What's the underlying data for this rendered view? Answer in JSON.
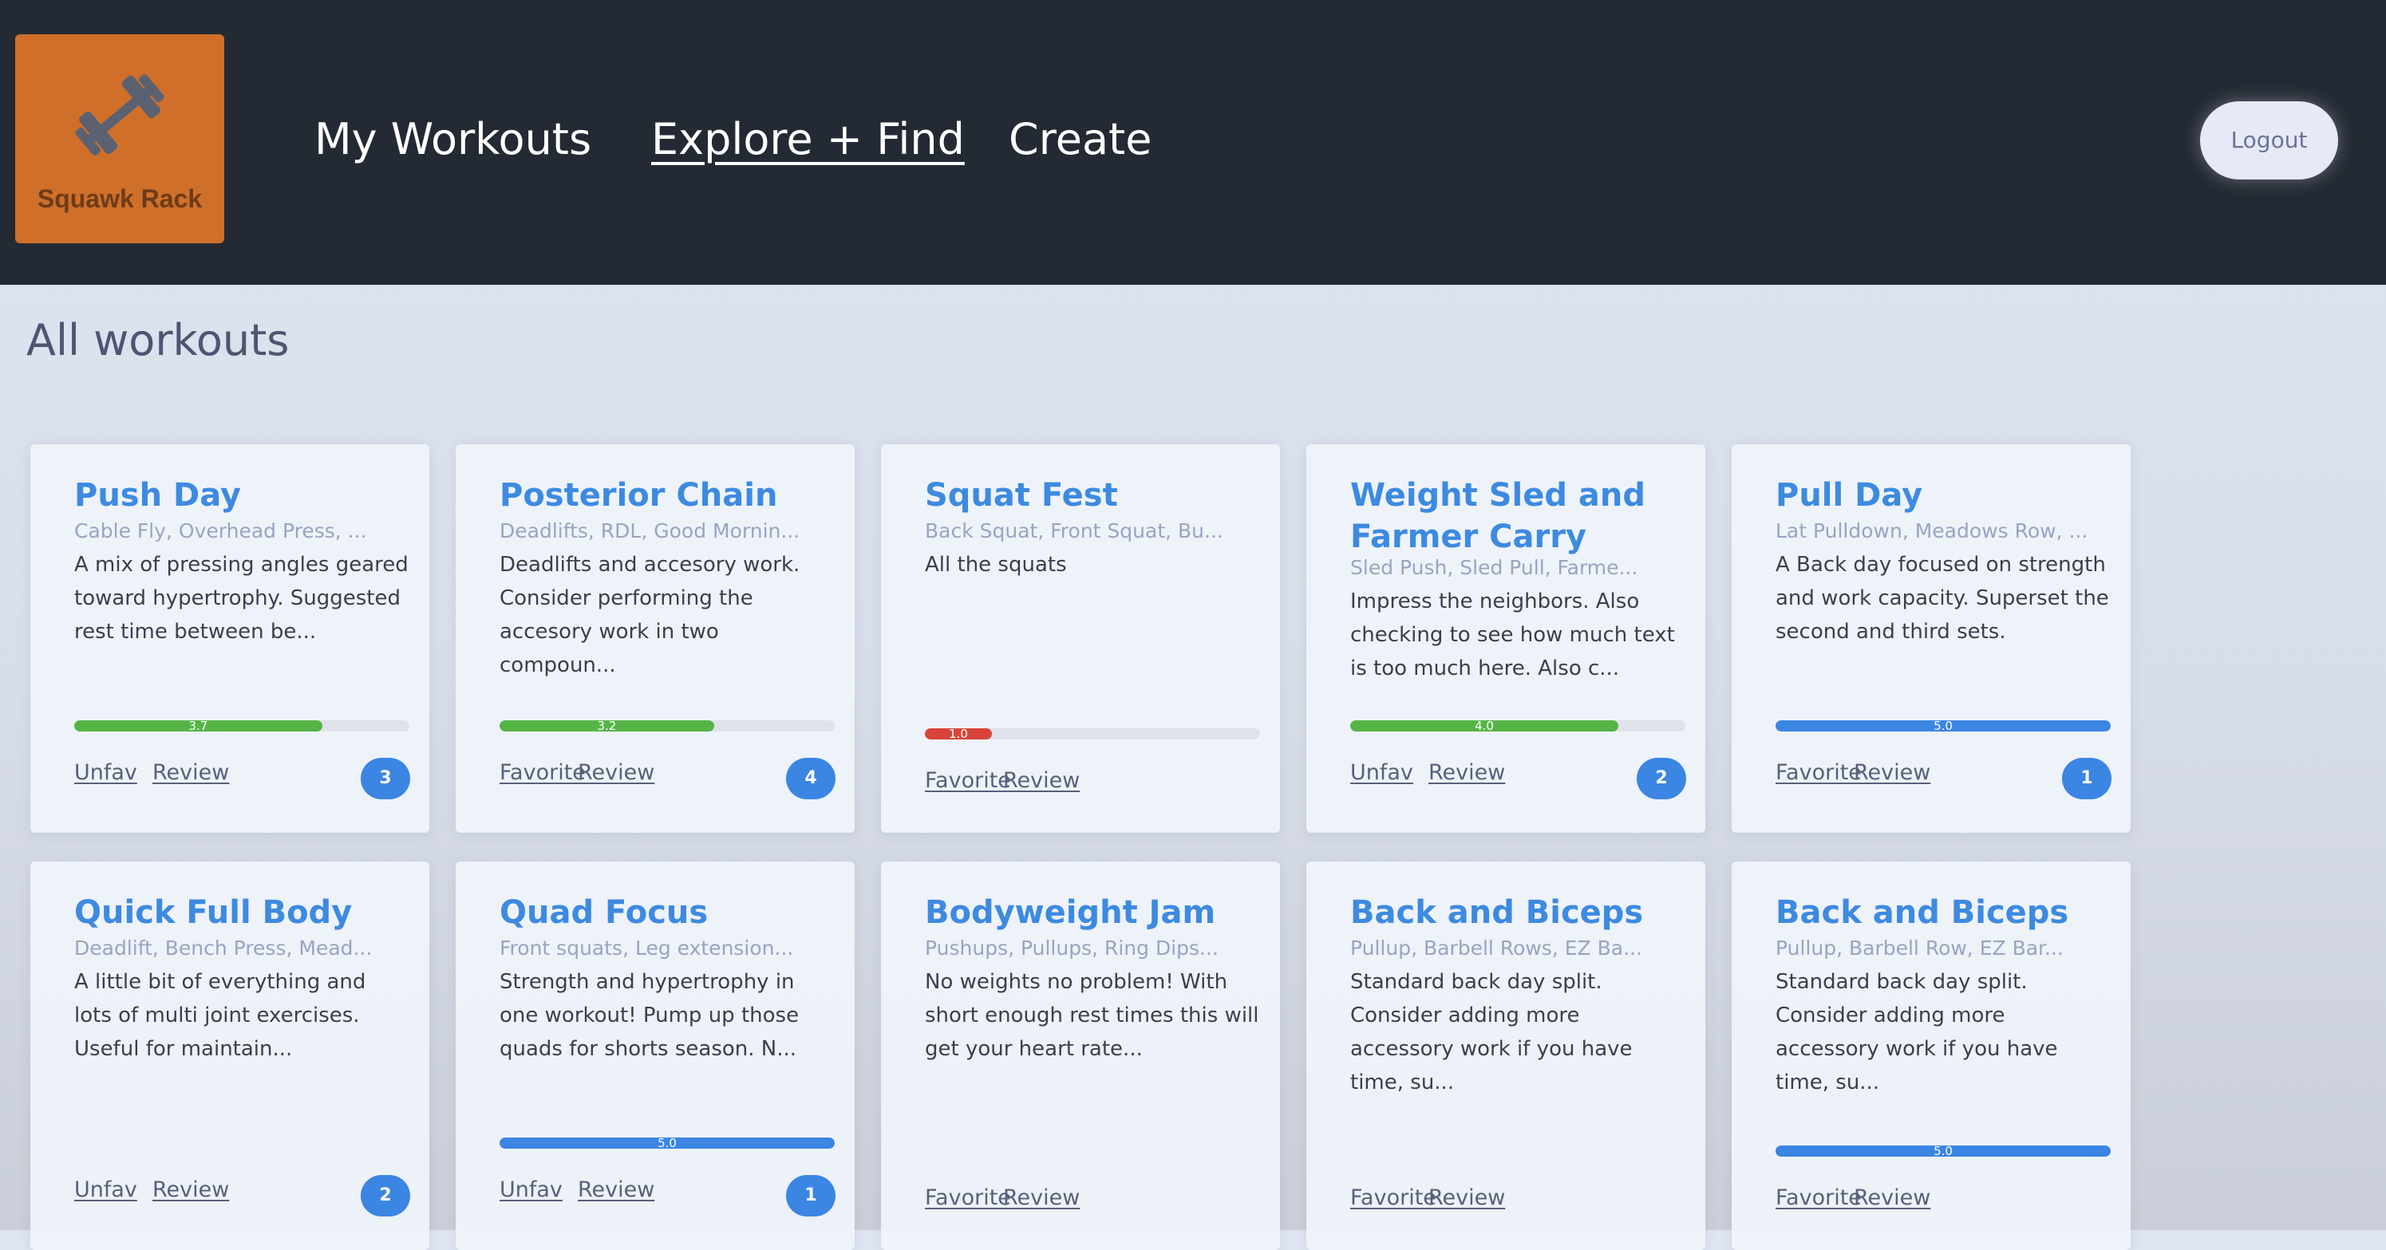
{
  "app": {
    "logo_text": "Squawk Rack",
    "nav": [
      {
        "label": "My Workouts"
      },
      {
        "label": "Explore + Find"
      },
      {
        "label": "Create"
      }
    ],
    "logout_label": "Logout"
  },
  "main": {
    "title": "All workouts"
  },
  "colors": {
    "accent": "#3d8ae0",
    "rating_green": "#56b447",
    "rating_red": "#d9443a",
    "rating_blue": "#3b85e3",
    "logo_orange": "#cf6f2a"
  },
  "workouts": [
    {
      "title": "Push Day",
      "exercises": "Cable Fly, Overhead Press, ...",
      "description": "A mix of pressing angles geared toward hypertrophy. Suggested rest time between be...",
      "rating": 3.7,
      "rating_label": "3.7",
      "rating_color": "#56b447",
      "fav_label": "Unfav",
      "review_label": "Review",
      "count": "3"
    },
    {
      "title": "Posterior Chain",
      "exercises": "Deadlifts, RDL, Good Mornin...",
      "description": "Deadlifts and accesory work. Consider performing the accesory work in two compoun...",
      "rating": 3.2,
      "rating_label": "3.2",
      "rating_color": "#56b447",
      "fav_label": "Favorite",
      "review_label": "Review",
      "count": "4"
    },
    {
      "title": "Squat Fest",
      "exercises": "Back Squat, Front Squat, Bu...",
      "description": "All the squats",
      "rating": 1.0,
      "rating_label": "1.0",
      "rating_color": "#d9443a",
      "fav_label": "Favorite",
      "review_label": "Review",
      "count": ""
    },
    {
      "title": "Weight Sled and Farmer Carry",
      "exercises": "Sled Push, Sled Pull, Farme...",
      "description": "Impress the neighbors. Also checking to see how much text is too much here. Also c...",
      "rating": 4.0,
      "rating_label": "4.0",
      "rating_color": "#56b447",
      "fav_label": "Unfav",
      "review_label": "Review",
      "count": "2"
    },
    {
      "title": "Pull Day",
      "exercises": "Lat Pulldown, Meadows Row, ...",
      "description": "A Back day focused on strength and work capacity. Superset the second and third sets.",
      "rating": 5.0,
      "rating_label": "5.0",
      "rating_color": "#3b85e3",
      "fav_label": "Favorite",
      "review_label": "Review",
      "count": "1"
    },
    {
      "title": "Quick Full Body",
      "exercises": "Deadlift, Bench Press, Mead...",
      "description": "A little bit of everything and lots of multi joint exercises. Useful for maintain...",
      "rating": null,
      "rating_label": "",
      "rating_color": "",
      "fav_label": "Unfav",
      "review_label": "Review",
      "count": "2"
    },
    {
      "title": "Quad Focus",
      "exercises": "Front squats, Leg extension...",
      "description": "Strength and hypertrophy in one workout! Pump up those quads for shorts season. N...",
      "rating": 5.0,
      "rating_label": "5.0",
      "rating_color": "#3b85e3",
      "fav_label": "Unfav",
      "review_label": "Review",
      "count": "1"
    },
    {
      "title": "Bodyweight Jam",
      "exercises": "Pushups, Pullups, Ring Dips...",
      "description": "No weights no problem! With short enough rest times this will get your heart rate...",
      "rating": null,
      "rating_label": "",
      "rating_color": "",
      "fav_label": "Favorite",
      "review_label": "Review",
      "count": ""
    },
    {
      "title": "Back and Biceps",
      "exercises": "Pullup, Barbell Rows, EZ Ba...",
      "description": "Standard back day split. Consider adding more accessory work if you have time, su...",
      "rating": null,
      "rating_label": "",
      "rating_color": "",
      "fav_label": "Favorite",
      "review_label": "Review",
      "count": ""
    },
    {
      "title": "Back and Biceps",
      "exercises": "Pullup, Barbell Row, EZ Bar...",
      "description": "Standard back day split. Consider adding more accessory work if you have time, su...",
      "rating": 5.0,
      "rating_label": "5.0",
      "rating_color": "#3b85e3",
      "fav_label": "Favorite",
      "review_label": "Review",
      "count": ""
    }
  ]
}
